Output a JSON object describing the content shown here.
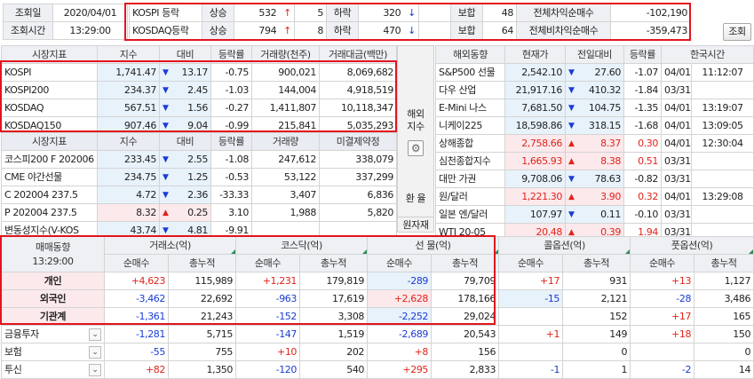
{
  "header": {
    "lookup_date_label": "조회일",
    "lookup_date": "2020/04/01",
    "lookup_time_label": "조회시간",
    "lookup_time": "13:29:00",
    "rows": [
      {
        "market": "KOSPI 등락",
        "up_label": "상승",
        "up": "532",
        "up_arrow": "↑",
        "up_limit": "5",
        "down_label": "하락",
        "down": "320",
        "down_arrow": "↓",
        "flat_label": "보합",
        "flat": "48",
        "arb_label": "전체차익순매수",
        "arb": "-102,190"
      },
      {
        "market": "KOSDAQ등락",
        "up_label": "상승",
        "up": "794",
        "up_arrow": "↑",
        "up_limit": "8",
        "down_label": "하락",
        "down": "470",
        "down_arrow": "↓",
        "flat_label": "보합",
        "flat": "64",
        "arb_label": "전체비차익순매수",
        "arb": "-359,473"
      }
    ],
    "lookup_button": "조회"
  },
  "index_table": {
    "headers": [
      "시장지표",
      "지수",
      "대비",
      "등락률",
      "거래량(천주)",
      "거래대금(백만)"
    ],
    "rows": [
      {
        "name": "KOSPI",
        "index": "1,741.47",
        "arrow": "▼",
        "change": "13.17",
        "rate": "-0.75",
        "volume": "900,021",
        "value": "8,069,682",
        "dir": "dn"
      },
      {
        "name": "KOSPI200",
        "index": "234.37",
        "arrow": "▼",
        "change": "2.45",
        "rate": "-1.03",
        "volume": "144,004",
        "value": "4,918,519",
        "dir": "dn"
      },
      {
        "name": "KOSDAQ",
        "index": "567.51",
        "arrow": "▼",
        "change": "1.56",
        "rate": "-0.27",
        "volume": "1,411,807",
        "value": "10,118,347",
        "dir": "dn"
      },
      {
        "name": "KOSDAQ150",
        "index": "907.46",
        "arrow": "▼",
        "change": "9.04",
        "rate": "-0.99",
        "volume": "215,841",
        "value": "5,035,293",
        "dir": "dn"
      }
    ]
  },
  "futures_table": {
    "headers": [
      "시장지표",
      "지수",
      "대비",
      "등락률",
      "거래량",
      "미결제약정"
    ],
    "rows": [
      {
        "name": "코스피200 F 202006",
        "index": "233.45",
        "arrow": "▼",
        "change": "2.55",
        "rate": "-1.08",
        "volume": "247,612",
        "oi": "338,079",
        "dir": "dn"
      },
      {
        "name": "CME 야간선물",
        "index": "234.75",
        "arrow": "▼",
        "change": "1.25",
        "rate": "-0.53",
        "volume": "53,122",
        "oi": "337,299",
        "dir": "dn"
      },
      {
        "name": "C 202004 237.5",
        "index": "4.72",
        "arrow": "▼",
        "change": "2.36",
        "rate": "-33.33",
        "volume": "3,407",
        "oi": "6,836",
        "dir": "dn"
      },
      {
        "name": "P 202004 237.5",
        "index": "8.32",
        "arrow": "▲",
        "change": "0.25",
        "rate": "3.10",
        "volume": "1,988",
        "oi": "5,820",
        "dir": "up"
      },
      {
        "name": "변동성지수(V-KOS",
        "index": "43.74",
        "arrow": "▼",
        "change": "4.81",
        "rate": "-9.91",
        "volume": "",
        "oi": "",
        "dir": "dn"
      }
    ]
  },
  "side_tabs": {
    "overseas": "해외\n지수",
    "fx": "환 율",
    "commodity": "원자재"
  },
  "overseas_table": {
    "headers": [
      "해외동향",
      "현재가",
      "전일대비",
      "등락률",
      "한국시간"
    ],
    "rows": [
      {
        "name": "S&P500 선물",
        "price": "2,542.10",
        "arrow": "▼",
        "change": "27.60",
        "rate": "-1.07",
        "date": "04/01",
        "time": "11:12:07",
        "dir": "dn"
      },
      {
        "name": "다우 산업",
        "price": "21,917.16",
        "arrow": "▼",
        "change": "410.32",
        "rate": "-1.84",
        "date": "03/31",
        "time": "",
        "dir": "dn"
      },
      {
        "name": "E-Mini 나스",
        "price": "7,681.50",
        "arrow": "▼",
        "change": "104.75",
        "rate": "-1.35",
        "date": "04/01",
        "time": "13:19:07",
        "dir": "dn"
      },
      {
        "name": "니케이225",
        "price": "18,598.86",
        "arrow": "▼",
        "change": "318.15",
        "rate": "-1.68",
        "date": "04/01",
        "time": "13:09:05",
        "dir": "dn"
      },
      {
        "name": "상해종합",
        "price": "2,758.66",
        "arrow": "▲",
        "change": "8.37",
        "rate": "0.30",
        "date": "04/01",
        "time": "12:30:04",
        "dir": "up"
      },
      {
        "name": "심천종합지수",
        "price": "1,665.93",
        "arrow": "▲",
        "change": "8.38",
        "rate": "0.51",
        "date": "03/31",
        "time": "",
        "dir": "up"
      },
      {
        "name": "대만 가권",
        "price": "9,708.06",
        "arrow": "▼",
        "change": "78.63",
        "rate": "-0.82",
        "date": "03/31",
        "time": "",
        "dir": "dn"
      },
      {
        "name": "원/달러",
        "price": "1,221.30",
        "arrow": "▲",
        "change": "3.90",
        "rate": "0.32",
        "date": "04/01",
        "time": "13:29:08",
        "dir": "up"
      },
      {
        "name": "일본 엔/달러",
        "price": "107.97",
        "arrow": "▼",
        "change": "0.11",
        "rate": "-0.10",
        "date": "03/31",
        "time": "",
        "dir": "dn"
      },
      {
        "name": "WTI 20-05",
        "price": "20.48",
        "arrow": "▲",
        "change": "0.39",
        "rate": "1.94",
        "date": "03/31",
        "time": "",
        "dir": "up"
      }
    ]
  },
  "trading_table": {
    "title": "매매동향",
    "time": "13:29:00",
    "groups": [
      "거래소(억)",
      "코스닥(억)",
      "선  물(억)",
      "콜옵션(억)",
      "풋옵션(억)"
    ],
    "sub": [
      "순매수",
      "총누적"
    ],
    "rows": [
      {
        "name": "개인",
        "vals": [
          "+4,623",
          "115,989",
          "+1,231",
          "179,819",
          "-289",
          "79,709",
          "+17",
          "931",
          "+13",
          "1,127"
        ],
        "hl": true
      },
      {
        "name": "외국인",
        "vals": [
          "-3,462",
          "22,692",
          "-963",
          "17,619",
          "+2,628",
          "178,166",
          "-15",
          "2,121",
          "-28",
          "3,486"
        ],
        "hl": true
      },
      {
        "name": "기관계",
        "vals": [
          "-1,361",
          "21,243",
          "-152",
          "3,308",
          "-2,252",
          "29,024",
          "",
          "152",
          "+17",
          "165"
        ],
        "hl": true
      },
      {
        "name": "금융투자",
        "vals": [
          "-1,281",
          "5,715",
          "-147",
          "1,519",
          "-2,689",
          "20,543",
          "+1",
          "149",
          "+18",
          "150"
        ],
        "hl": false,
        "dd": true
      },
      {
        "name": "보험",
        "vals": [
          "-55",
          "755",
          "+10",
          "202",
          "+8",
          "156",
          "",
          "0",
          "",
          "0"
        ],
        "hl": false,
        "dd": true
      },
      {
        "name": "투신",
        "vals": [
          "+82",
          "1,350",
          "-120",
          "540",
          "+295",
          "2,833",
          "-1",
          "1",
          "-2",
          "14"
        ],
        "hl": false,
        "dd": true
      }
    ]
  },
  "colors": {
    "up": "#e2231a",
    "down": "#1a3bd6",
    "highlight_box": "#e2141e",
    "header_bg": "#eef0f4"
  }
}
